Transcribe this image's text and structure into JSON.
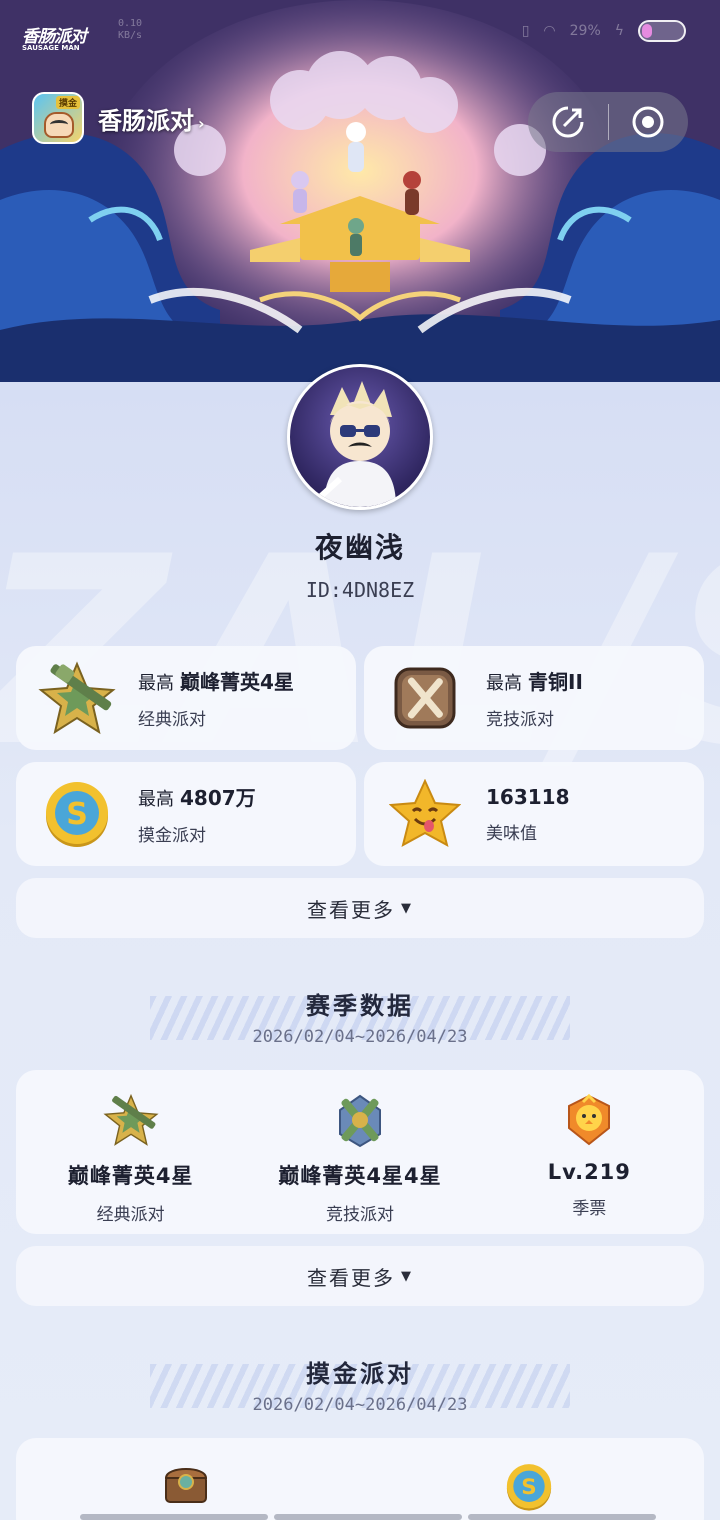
{
  "status_bar": {
    "logo_main": "香肠派对",
    "logo_sub": "SAUSAGE MAN",
    "speed_value": "0.10",
    "speed_unit": "KB/s",
    "battery": "29%"
  },
  "header": {
    "app_name": "香肠派对",
    "app_icon_tag": "摸金",
    "chevron": "›"
  },
  "profile": {
    "nickname": "夜幽浅",
    "id": "ID:4DN8EZ"
  },
  "stats": [
    {
      "prefix": "最高",
      "value": "巅峰菁英4星",
      "label": "经典派对",
      "icon": "rifle-star-icon"
    },
    {
      "prefix": "最高",
      "value": "青铜II",
      "label": "竞技派对",
      "icon": "bronze-shield-icon"
    },
    {
      "prefix": "最高",
      "value": "4807万",
      "label": "摸金派对",
      "icon": "gold-coin-icon"
    },
    {
      "prefix": "",
      "value": "163118",
      "label": "美味值",
      "icon": "tongue-star-icon"
    }
  ],
  "more_label": "查看更多",
  "more_arrow": "▼",
  "season": {
    "title": "赛季数据",
    "range": "2026/02/04~2026/04/23",
    "items": [
      {
        "value": "巅峰菁英4星",
        "label": "经典派对",
        "icon": "rifle-star-icon"
      },
      {
        "value": "巅峰菁英4星4星",
        "label": "竞技派对",
        "icon": "crossed-rifles-icon"
      },
      {
        "value": "Lv.219",
        "label": "季票",
        "icon": "chick-badge-icon"
      }
    ]
  },
  "gold_party": {
    "title": "摸金派对",
    "range": "2026/02/04~2026/04/23",
    "icons": [
      "treasure-chest-icon",
      "gold-coin-icon"
    ]
  },
  "colors": {
    "page_bg": "#e3e9f7",
    "card_bg": "#f6f8fd",
    "text_dark": "#1d2030",
    "coin_gold": "#f2c12e"
  }
}
